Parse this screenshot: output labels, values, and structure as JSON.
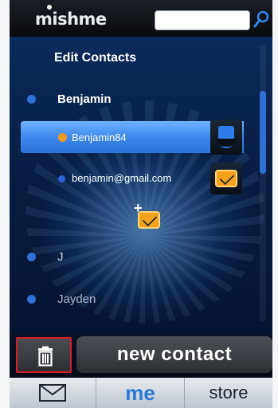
{
  "header": {
    "logo_text": "mishme",
    "search": {
      "value": "",
      "placeholder": ""
    }
  },
  "edit": {
    "title": "Edit Contacts",
    "contacts": [
      {
        "name": "Benjamin"
      },
      {
        "name": "J"
      },
      {
        "name": "Jayden"
      }
    ],
    "selected_account": "Benjamin84",
    "email": "benjamin@gmail.com"
  },
  "actions": {
    "new_contact_label": "new contact"
  },
  "tabs": {
    "me_label": "me",
    "store_label": "store"
  },
  "colors": {
    "accent": "#2e72d8",
    "highlight": "#d11f2b",
    "mail": "#f5a21b"
  },
  "icons": [
    "search-icon",
    "skype-icon",
    "mail-icon",
    "add-mail-icon",
    "trash-icon",
    "envelope-icon"
  ]
}
